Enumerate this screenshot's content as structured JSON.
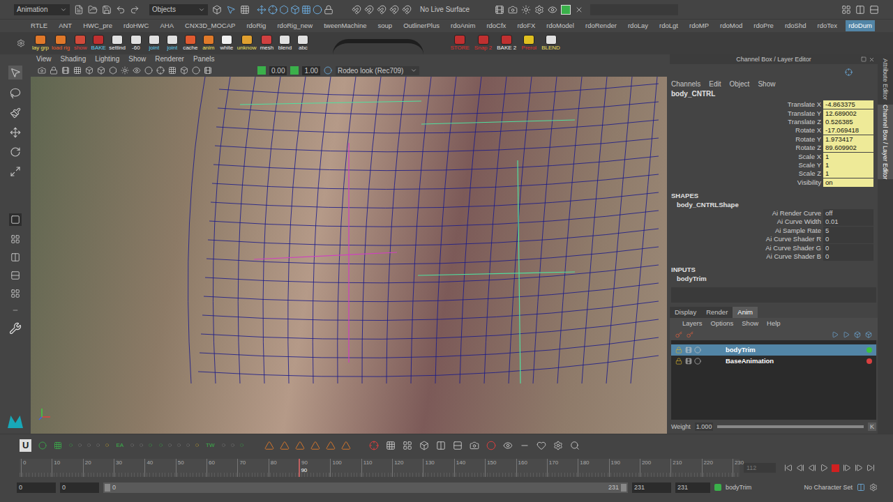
{
  "status_line": {
    "menu_set": "Animation",
    "selection_mode": "Objects",
    "live_surface": "No Live Surface"
  },
  "shelf_tabs": [
    {
      "label": "RTLE",
      "selected": false
    },
    {
      "label": "ANT",
      "selected": false
    },
    {
      "label": "HWC_pre",
      "selected": false
    },
    {
      "label": "rdoHWC",
      "selected": false
    },
    {
      "label": "AHA",
      "selected": false
    },
    {
      "label": "CNX3D_MOCAP",
      "selected": false
    },
    {
      "label": "rdoRig",
      "selected": false
    },
    {
      "label": "rdoRig_new",
      "selected": false
    },
    {
      "label": "tweenMachine",
      "selected": false
    },
    {
      "label": "soup",
      "selected": false
    },
    {
      "label": "OutlinerPlus",
      "selected": false
    },
    {
      "label": "rdoAnim",
      "selected": false
    },
    {
      "label": "rdoCfx",
      "selected": false
    },
    {
      "label": "rdoFX",
      "selected": false
    },
    {
      "label": "rdoModel",
      "selected": false
    },
    {
      "label": "rdoRender",
      "selected": false
    },
    {
      "label": "rdoLay",
      "selected": false
    },
    {
      "label": "rdoLgt",
      "selected": false
    },
    {
      "label": "rdoMP",
      "selected": false
    },
    {
      "label": "rdoMod",
      "selected": false
    },
    {
      "label": "rdoPre",
      "selected": false
    },
    {
      "label": "rdoShd",
      "selected": false
    },
    {
      "label": "rdoTex",
      "selected": false
    },
    {
      "label": "rdoDum",
      "selected": true
    }
  ],
  "shelf_left": [
    {
      "label": "lay grp",
      "color": "#e0782a",
      "label_color": "#f0e060"
    },
    {
      "label": "load rig",
      "color": "#e0782a",
      "label_color": "#f06030"
    },
    {
      "label": "show",
      "color": "#d04a3a",
      "label_color": "#e04040"
    },
    {
      "label": "BAKE",
      "color": "#c03030",
      "label_color": "#60d0f0"
    },
    {
      "label": "settind",
      "color": "#e0e0e0",
      "label_color": "#f0f0f0"
    },
    {
      "label": "-60",
      "color": "#e0e0e0",
      "label_color": "#f0f0f0"
    },
    {
      "label": "joint",
      "color": "#e0e0e0",
      "label_color": "#60d0f0"
    },
    {
      "label": "joint",
      "color": "#e0e0e0",
      "label_color": "#60d0f0"
    },
    {
      "label": "cache",
      "color": "#e05a30",
      "label_color": "#f0f0f0"
    },
    {
      "label": "anim",
      "color": "#e07a2a",
      "label_color": "#f0e060"
    },
    {
      "label": "white",
      "color": "#f0f0f0",
      "label_color": "#f0f0f0"
    },
    {
      "label": "unknow",
      "color": "#e0a030",
      "label_color": "#f0e060"
    },
    {
      "label": "mesh",
      "color": "#d04040",
      "label_color": "#f0f0f0"
    },
    {
      "label": "blend",
      "color": "#e0e0e0",
      "label_color": "#f0f0f0"
    },
    {
      "label": "abc",
      "color": "#e0e0e0",
      "label_color": "#f0f0f0"
    }
  ],
  "shelf_right": [
    {
      "label": "STORE",
      "color": "#c03030",
      "label_color": "#e03030"
    },
    {
      "label": "Snap 2",
      "color": "#c03030",
      "label_color": "#e03030"
    },
    {
      "label": "BAKE 2",
      "color": "#c03030",
      "label_color": "#f0f0f0"
    },
    {
      "label": "Prerol",
      "color": "#e0c020",
      "label_color": "#e03030"
    },
    {
      "label": "BLEND",
      "color": "#e0e0e0",
      "label_color": "#f0e060"
    }
  ],
  "viewport": {
    "menus": [
      "View",
      "Shading",
      "Lighting",
      "Show",
      "Renderer",
      "Panels"
    ],
    "exposure": "0.00",
    "gamma": "1.00",
    "color_space": "Rodeo look (Rec709)"
  },
  "channel_box": {
    "title": "Channel Box / Layer Editor",
    "menus": [
      "Channels",
      "Edit",
      "Object",
      "Show"
    ],
    "object": "body_CNTRL",
    "channels": [
      {
        "name": "Translate X",
        "value": "-4.863375",
        "keyed": true
      },
      {
        "name": "Translate Y",
        "value": "12.689002",
        "keyed": true
      },
      {
        "name": "Translate Z",
        "value": "0.526385",
        "keyed": true
      },
      {
        "name": "Rotate X",
        "value": "-17.069418",
        "keyed": true
      },
      {
        "name": "Rotate Y",
        "value": "1.973417",
        "keyed": true
      },
      {
        "name": "Rotate Z",
        "value": "89.609902",
        "keyed": true
      },
      {
        "name": "Scale X",
        "value": "1",
        "keyed": true
      },
      {
        "name": "Scale Y",
        "value": "1",
        "keyed": true
      },
      {
        "name": "Scale Z",
        "value": "1",
        "keyed": true
      },
      {
        "name": "Visibility",
        "value": "on",
        "keyed": true
      }
    ],
    "shapes_heading": "SHAPES",
    "shape": "body_CNTRLShape",
    "shape_channels": [
      {
        "name": "Ai Render Curve",
        "value": "off",
        "keyed": false
      },
      {
        "name": "Ai Curve Width",
        "value": "0.01",
        "keyed": false
      },
      {
        "name": "Ai Sample Rate",
        "value": "5",
        "keyed": false
      },
      {
        "name": "Ai Curve Shader R",
        "value": "0",
        "keyed": false
      },
      {
        "name": "Ai Curve Shader G",
        "value": "0",
        "keyed": false
      },
      {
        "name": "Ai Curve Shader B",
        "value": "0",
        "keyed": false
      }
    ],
    "inputs_heading": "INPUTS",
    "inputs": [
      "bodyTrim"
    ]
  },
  "layer_editor": {
    "tabs": [
      {
        "label": "Display",
        "selected": false
      },
      {
        "label": "Render",
        "selected": false
      },
      {
        "label": "Anim",
        "selected": true
      }
    ],
    "menus": [
      "Layers",
      "Options",
      "Show",
      "Help"
    ],
    "layers": [
      {
        "name": "bodyTrim",
        "selected": true,
        "color": "#3cc23c"
      },
      {
        "name": "BaseAnimation",
        "selected": false,
        "color": "#d94040"
      }
    ],
    "weight_label": "Weight",
    "weight": "1.000",
    "weight_level": 1.0,
    "key_button": "K"
  },
  "side_tabs": [
    {
      "label": "Attribute Editor",
      "selected": false
    },
    {
      "label": "Channel Box / Layer Editor",
      "selected": true
    }
  ],
  "anim_toolbar": {
    "u_button": "U",
    "labels": [
      "EA",
      "TW"
    ]
  },
  "time_slider": {
    "ticks": [
      "0",
      "10",
      "20",
      "30",
      "40",
      "50",
      "60",
      "70",
      "80",
      "90",
      "100",
      "110",
      "120",
      "130",
      "140",
      "150",
      "160",
      "170",
      "180",
      "190",
      "200",
      "210",
      "220",
      "230"
    ],
    "current_frame": "90",
    "playhead_level": 0.388,
    "frame_field": "112"
  },
  "range_slider": {
    "start": "0",
    "playback_start": "0",
    "bar_start": "0",
    "bar_end": "231",
    "playback_end": "231",
    "end": "231",
    "anim_layer": "bodyTrim",
    "character_set": "No Character Set"
  }
}
